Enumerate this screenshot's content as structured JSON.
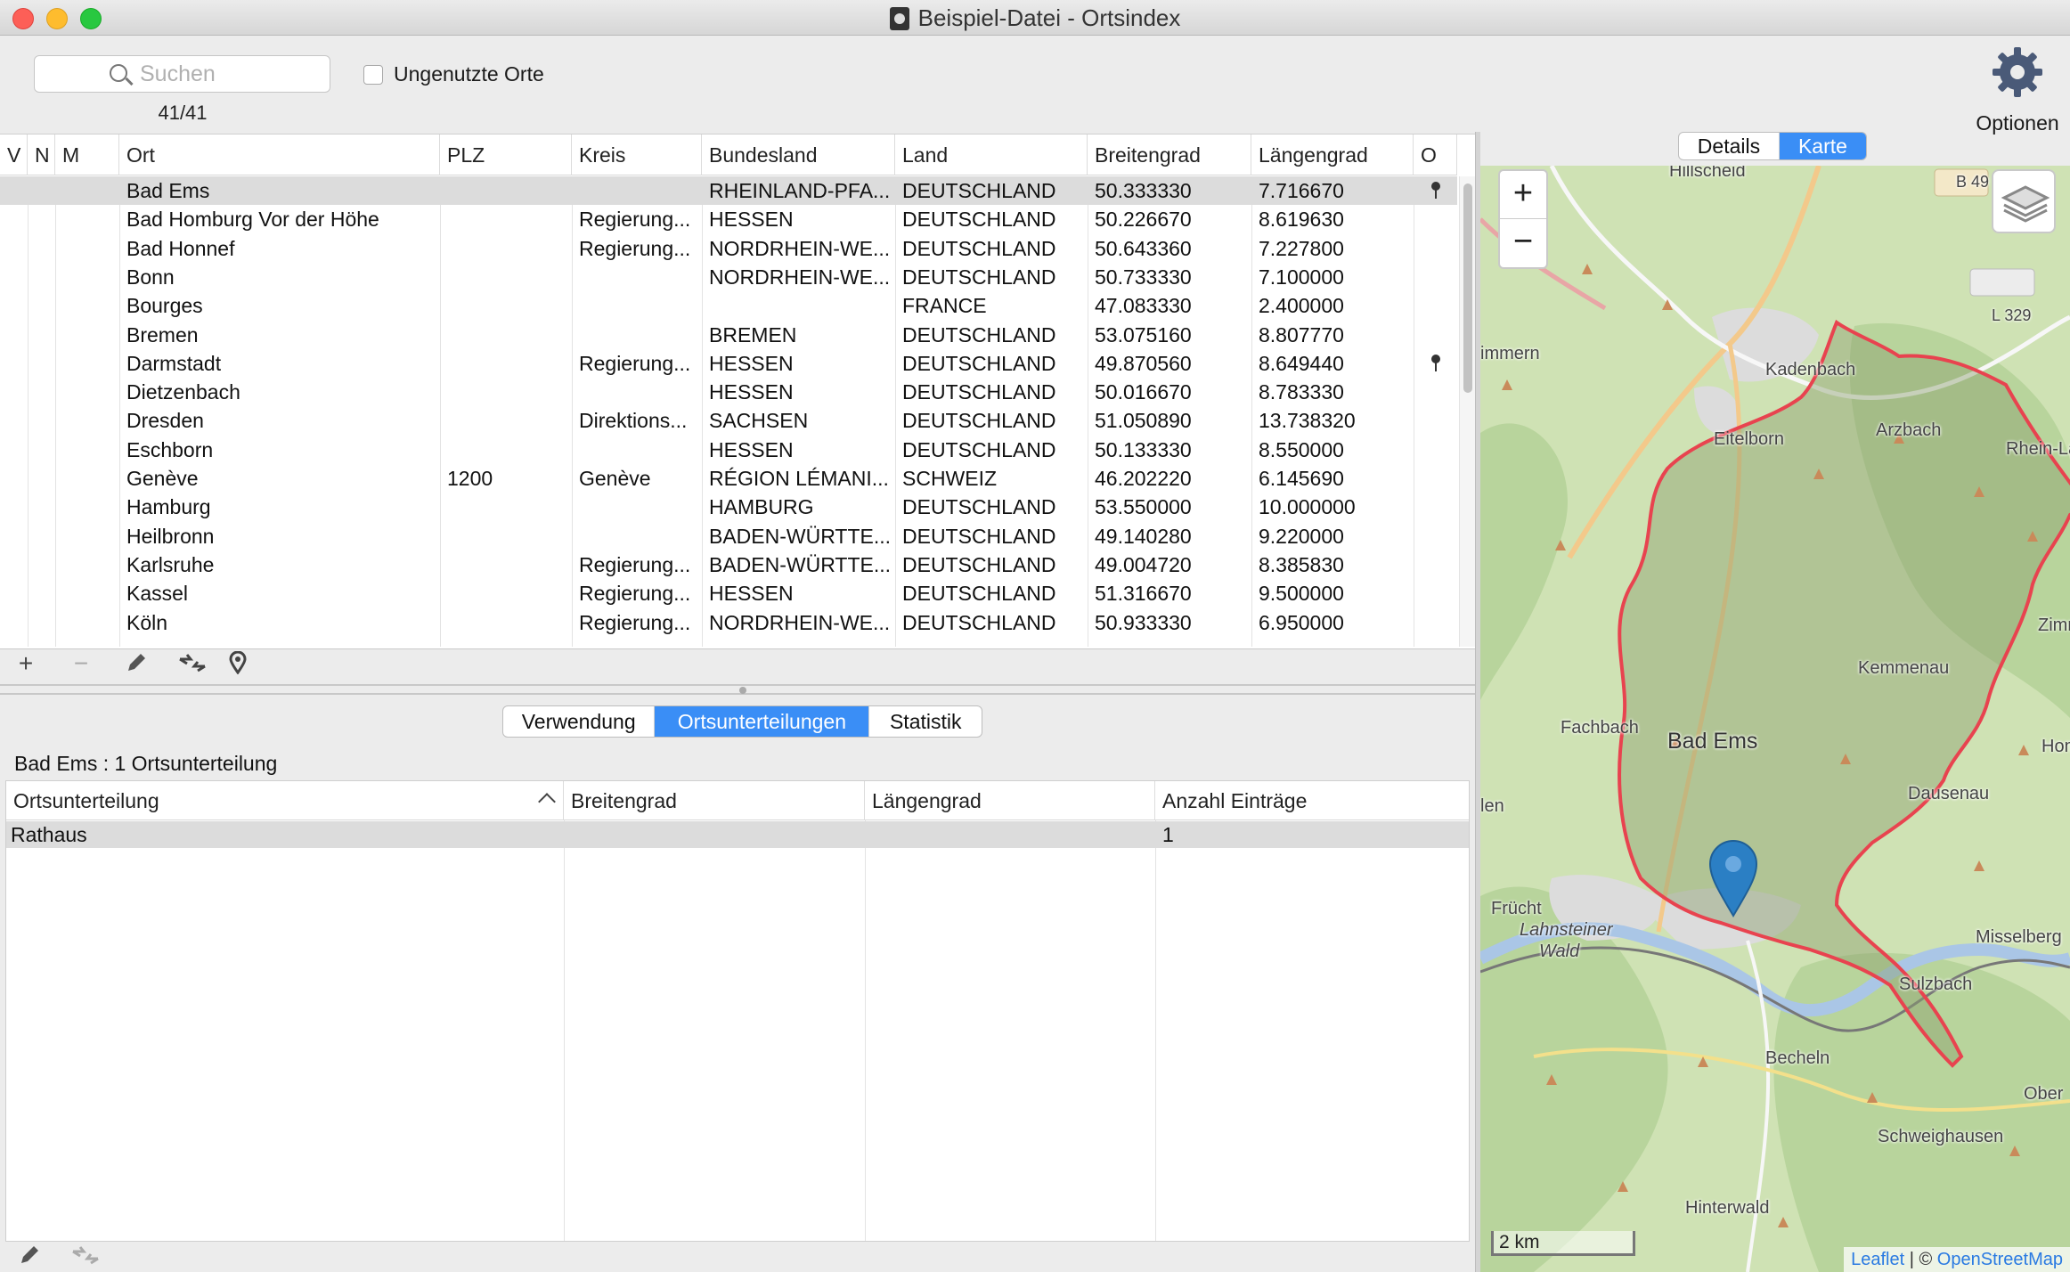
{
  "window": {
    "title": "Beispiel-Datei - Ortsindex"
  },
  "toolbar": {
    "search_placeholder": "Suchen",
    "count": "41/41",
    "unused_label": "Ungenutzte Orte",
    "options_label": "Optionen"
  },
  "right_tabs": [
    "Details",
    "Karte"
  ],
  "places": {
    "columns": [
      "V",
      "N",
      "M",
      "Ort",
      "PLZ",
      "Kreis",
      "Bundesland",
      "Land",
      "Breitengrad",
      "Längengrad",
      "O"
    ],
    "rows": [
      {
        "ort": "Bad Ems",
        "plz": "",
        "kreis": "",
        "bundesland": "RHEINLAND-PFA...",
        "land": "DEUTSCHLAND",
        "lat": "50.333330",
        "lon": "7.716670",
        "pin": true
      },
      {
        "ort": "Bad Homburg Vor der Höhe",
        "plz": "",
        "kreis": "Regierung...",
        "bundesland": "HESSEN",
        "land": "DEUTSCHLAND",
        "lat": "50.226670",
        "lon": "8.619630",
        "pin": false
      },
      {
        "ort": "Bad Honnef",
        "plz": "",
        "kreis": "Regierung...",
        "bundesland": "NORDRHEIN-WE...",
        "land": "DEUTSCHLAND",
        "lat": "50.643360",
        "lon": "7.227800",
        "pin": false
      },
      {
        "ort": "Bonn",
        "plz": "",
        "kreis": "",
        "bundesland": "NORDRHEIN-WE...",
        "land": "DEUTSCHLAND",
        "lat": "50.733330",
        "lon": "7.100000",
        "pin": false
      },
      {
        "ort": "Bourges",
        "plz": "",
        "kreis": "",
        "bundesland": "",
        "land": "FRANCE",
        "lat": "47.083330",
        "lon": "2.400000",
        "pin": false
      },
      {
        "ort": "Bremen",
        "plz": "",
        "kreis": "",
        "bundesland": "BREMEN",
        "land": "DEUTSCHLAND",
        "lat": "53.075160",
        "lon": "8.807770",
        "pin": false
      },
      {
        "ort": "Darmstadt",
        "plz": "",
        "kreis": "Regierung...",
        "bundesland": "HESSEN",
        "land": "DEUTSCHLAND",
        "lat": "49.870560",
        "lon": "8.649440",
        "pin": true
      },
      {
        "ort": "Dietzenbach",
        "plz": "",
        "kreis": "",
        "bundesland": "HESSEN",
        "land": "DEUTSCHLAND",
        "lat": "50.016670",
        "lon": "8.783330",
        "pin": false
      },
      {
        "ort": "Dresden",
        "plz": "",
        "kreis": "Direktions...",
        "bundesland": "SACHSEN",
        "land": "DEUTSCHLAND",
        "lat": "51.050890",
        "lon": "13.738320",
        "pin": false
      },
      {
        "ort": "Eschborn",
        "plz": "",
        "kreis": "",
        "bundesland": "HESSEN",
        "land": "DEUTSCHLAND",
        "lat": "50.133330",
        "lon": "8.550000",
        "pin": false
      },
      {
        "ort": "Genève",
        "plz": "1200",
        "kreis": "Genève",
        "bundesland": "RÉGION LÉMANI...",
        "land": "SCHWEIZ",
        "lat": "46.202220",
        "lon": "6.145690",
        "pin": false
      },
      {
        "ort": "Hamburg",
        "plz": "",
        "kreis": "",
        "bundesland": "HAMBURG",
        "land": "DEUTSCHLAND",
        "lat": "53.550000",
        "lon": "10.000000",
        "pin": false
      },
      {
        "ort": "Heilbronn",
        "plz": "",
        "kreis": "",
        "bundesland": "BADEN-WÜRTTE...",
        "land": "DEUTSCHLAND",
        "lat": "49.140280",
        "lon": "9.220000",
        "pin": false
      },
      {
        "ort": "Karlsruhe",
        "plz": "",
        "kreis": "Regierung...",
        "bundesland": "BADEN-WÜRTTE...",
        "land": "DEUTSCHLAND",
        "lat": "49.004720",
        "lon": "8.385830",
        "pin": false
      },
      {
        "ort": "Kassel",
        "plz": "",
        "kreis": "Regierung...",
        "bundesland": "HESSEN",
        "land": "DEUTSCHLAND",
        "lat": "51.316670",
        "lon": "9.500000",
        "pin": false
      },
      {
        "ort": "Köln",
        "plz": "",
        "kreis": "Regierung...",
        "bundesland": "NORDRHEIN-WE...",
        "land": "DEUTSCHLAND",
        "lat": "50.933330",
        "lon": "6.950000",
        "pin": false
      }
    ]
  },
  "table_tools": [
    "plus-icon",
    "minus-icon",
    "pencil-icon",
    "merge-icon",
    "location-pin-icon"
  ],
  "bottom_tabs": [
    "Verwendung",
    "Ortsunterteilungen",
    "Statistik"
  ],
  "subdivisions": {
    "title": "Bad Ems : 1 Ortsunterteilung",
    "columns": [
      "Ortsunterteilung",
      "Breitengrad",
      "Längengrad",
      "Anzahl Einträge"
    ],
    "rows": [
      {
        "name": "Rathaus",
        "lat": "",
        "lon": "",
        "count": "1"
      }
    ]
  },
  "map": {
    "zoom_in": "+",
    "zoom_out": "−",
    "scale": "2 km",
    "attribution_leaflet": "Leaflet",
    "attribution_sep": " | © ",
    "attribution_osm": "OpenStreetMap",
    "marker_label": "Bad Ems",
    "labels": [
      "Hillscheid",
      "B 49",
      "L 329",
      "immern",
      "Kadenbach",
      "Eitelborn",
      "Arzbach",
      "Rhein-Lahn-K",
      "Zimm",
      "Kemmenau",
      "Fachbach",
      "Hom",
      "len",
      "Dausenau",
      "Frücht",
      "Lahnsteiner",
      "Wald",
      "Misselberg",
      "Sulzbach",
      "Becheln",
      "Ober",
      "Schweighausen",
      "Hinterwald"
    ],
    "colors": {
      "land": "#cfe2b4",
      "forest": "#b5d29a",
      "boundary": "#e8434f",
      "marker": "#2b7fc4",
      "road": "#f3c98b"
    }
  }
}
